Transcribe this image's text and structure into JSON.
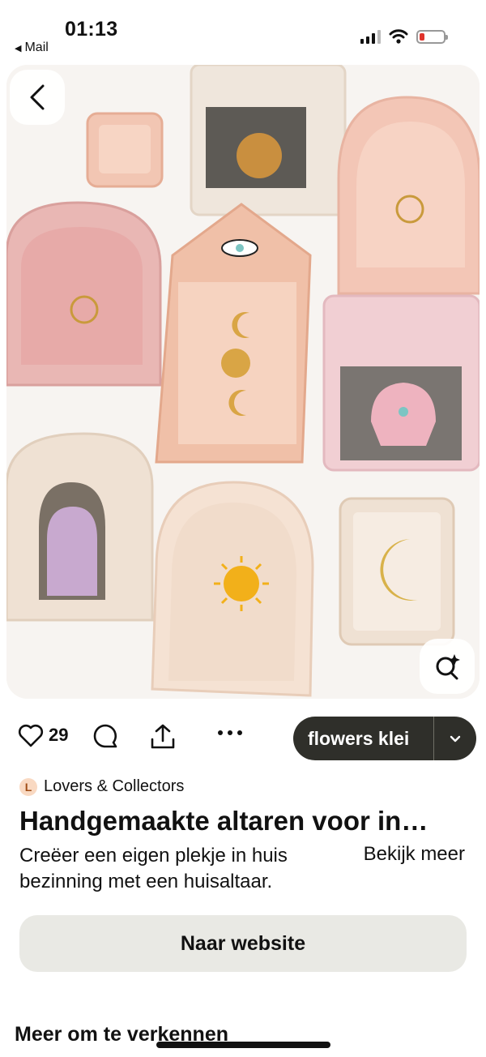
{
  "status_bar": {
    "time": "01:13",
    "back_app": "Mail",
    "battery_color": "#e0342c"
  },
  "pin": {
    "image_alt": "Handgemaakte keramieken huisaltaren",
    "like_count": "29",
    "board_name": "flowers klei",
    "source": {
      "avatar_letter": "L",
      "name": "Lovers & Collectors"
    },
    "title": "Handgemaakte altaren voor in…",
    "description_line1": "Creëer een eigen plekje in huis",
    "description_line2": "bezinning met een huisaltaar.",
    "see_more": "Bekijk meer",
    "website_button": "Naar website"
  },
  "section": {
    "explore_heading": "Meer om te verkennen"
  },
  "icons": {
    "back": "chevron-left-icon",
    "visual_search": "lens-sparkle-icon",
    "like": "heart-icon",
    "comment": "comment-icon",
    "share": "share-icon",
    "more": "ellipsis-icon",
    "board_dropdown": "chevron-down-icon"
  }
}
